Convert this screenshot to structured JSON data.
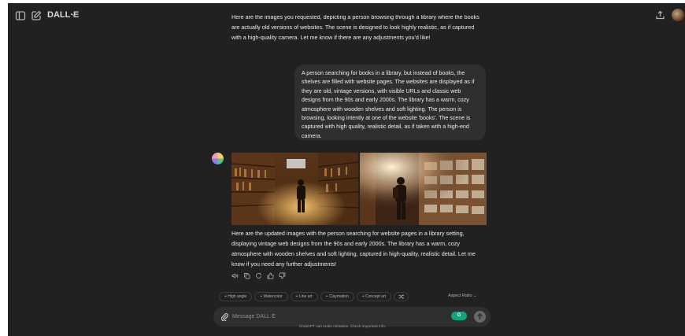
{
  "header": {
    "model_name": "DALL·E",
    "icons": [
      "sidebar-toggle-icon",
      "new-chat-icon",
      "chevron-down-icon",
      "share-icon",
      "user-avatar"
    ]
  },
  "messages": {
    "assistant_1_lines": [
      "Here are the images you requested, depicting a person browsing through a library where the books",
      "are actually old versions of websites. The scene is designed to look highly realistic, as if captured",
      "with a high-quality camera. Let me know if there are any adjustments you'd like!"
    ],
    "user_lines": [
      "A person searching for books in a library, but instead of books, the",
      "shelves are filled with website pages. The websites are displayed as if",
      "they are old, vintage versions, with visible URLs and classic web",
      "designs from the 90s and early 2000s. The library has a warm, cozy",
      "atmosphere with wooden shelves and soft lighting. The person is",
      "browsing, looking intently at one of the website 'books'. The scene is",
      "captured with high quality, realistic detail, as if taken with a high-end",
      "camera."
    ],
    "assistant_2_lines": [
      "Here are the updated images with the person searching for website pages in a library setting,",
      "displaying vintage web designs from the 90s and early 2000s. The library has a warm, cozy",
      "atmosphere with wooden shelves and soft lighting, captured in high-quality, realistic detail. Let me",
      "know if you need any further adjustments!"
    ],
    "actions": [
      "speaker-icon",
      "copy-icon",
      "regenerate-icon",
      "thumbs-up-icon",
      "thumbs-down-icon"
    ]
  },
  "style_chips": [
    "+ High angle",
    "+ Watercolor",
    "+ Line art",
    "+ Claymation",
    "+ Concept art"
  ],
  "aspect_ratio_label": "Aspect Ratio",
  "composer": {
    "placeholder": "Message DALL·E",
    "grammarly_badge": "G"
  },
  "footer_note": "ChatGPT can make mistakes. Check important info.",
  "colors": {
    "background": "#212121",
    "bubble": "#2f2f2f",
    "text": "#ececec",
    "grammarly": "#14a37f"
  }
}
